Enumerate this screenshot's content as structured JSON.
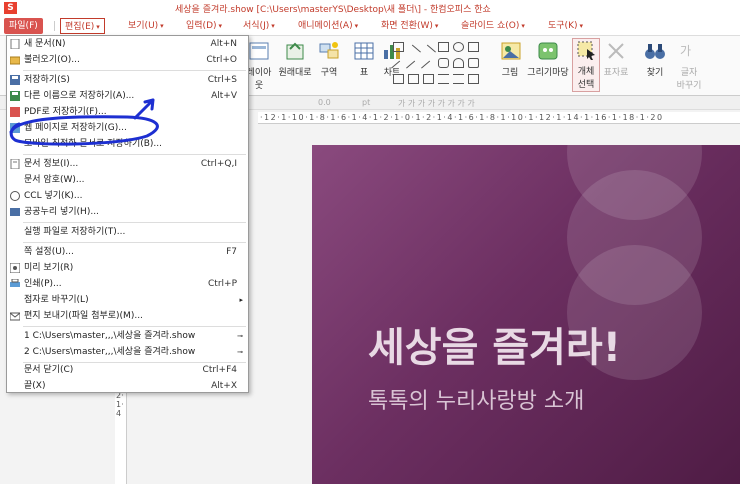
{
  "title_bar": {
    "app_logo": "S",
    "title": "세상을 즐겨라.show [C:\\Users\\masterYS\\Desktop\\새 폴더\\] - 한컴오피스 한쇼"
  },
  "menu": {
    "file": "파일(F)",
    "edit": "편집(E)",
    "view": "보기(U)",
    "insert": "입력(D)",
    "format": "서식(J)",
    "animation": "애니메이션(A)",
    "transition": "화면 전환(W)",
    "slideshow": "슬라이드 쇼(O)",
    "tools": "도구(K)",
    "arrow": "▾"
  },
  "toolbar": {
    "layout": "레이아웃",
    "original": "원래대로",
    "section": "구역",
    "table": "표",
    "chart": "차트",
    "picture": "그림",
    "drawing_market": "그리기마당",
    "select_object_1": "개체",
    "select_object_2": "선택",
    "transform": "표자료",
    "find": "찾기",
    "char_change_1": "글자",
    "char_change_2": "바꾸기"
  },
  "formatbar": {
    "size": "0.0",
    "unit": "pt",
    "font_preview": "가 가 가 가 가 가 가 가"
  },
  "ruler": {
    "horizontal": "·12·1·10·1·8·1·6·1·4·1·2·1·0·1·2·1·4·1·6·1·8·1·10·1·12·1·14·1·16·1·18·1·20",
    "vertical": "0·2·1·4"
  },
  "slide": {
    "title": "세상을 즐겨라!",
    "subtitle": "톡톡의 누리사랑방 소개"
  },
  "file_menu": {
    "items": [
      {
        "label": "새 문서(N)",
        "shortcut": "Alt+N",
        "icon": "new-document-icon"
      },
      {
        "label": "불러오기(O)...",
        "shortcut": "Ctrl+O",
        "icon": "open-folder-icon"
      },
      {
        "label": "저장하기(S)",
        "shortcut": "Ctrl+S",
        "icon": "save-icon"
      },
      {
        "label": "다른 이름으로 저장하기(A)...",
        "shortcut": "Alt+V",
        "icon": "save-as-icon"
      },
      {
        "label": "PDF로 저장하기(F)...",
        "shortcut": "",
        "icon": "pdf-icon"
      },
      {
        "label": "웹 페이지로 저장하기(G)...",
        "shortcut": "",
        "icon": "web-page-icon"
      },
      {
        "label": "모바일 최적화 문서로 저장하기(B)...",
        "shortcut": "",
        "icon": ""
      },
      {
        "label": "문서 정보(I)...",
        "shortcut": "Ctrl+Q,I",
        "icon": "document-info-icon"
      },
      {
        "label": "문서 암호(W)...",
        "shortcut": "",
        "icon": ""
      },
      {
        "label": "CCL 넣기(K)...",
        "shortcut": "",
        "icon": "ccl-icon"
      },
      {
        "label": "공공누리 넣기(H)...",
        "shortcut": "",
        "icon": "public-license-icon"
      },
      {
        "label": "실행 파일로 저장하기(T)...",
        "shortcut": "",
        "icon": ""
      },
      {
        "label": "쪽 설정(U)...",
        "shortcut": "F7",
        "icon": ""
      },
      {
        "label": "미리 보기(R)",
        "shortcut": "",
        "icon": "preview-icon"
      },
      {
        "label": "인쇄(P)...",
        "shortcut": "Ctrl+P",
        "icon": "print-icon"
      },
      {
        "label": "점자로 바꾸기(L)",
        "shortcut": "",
        "icon": ""
      },
      {
        "label": "편지 보내기(파일 첨부로)(M)...",
        "shortcut": "",
        "icon": "mail-icon"
      },
      {
        "label": "1 C:\\Users\\master,,,\\세상을 즐겨라.show",
        "shortcut": "",
        "icon": ""
      },
      {
        "label": "2 C:\\Users\\master,,,\\세상을 즐겨라.show",
        "shortcut": "",
        "icon": ""
      },
      {
        "label": "문서 닫기(C)",
        "shortcut": "Ctrl+F4",
        "icon": ""
      },
      {
        "label": "끝(X)",
        "shortcut": "Alt+X",
        "icon": ""
      }
    ]
  },
  "colors": {
    "accent": "#c23b2b",
    "annotation": "#1d2fd1",
    "slide_bg": "#6c2f61"
  }
}
